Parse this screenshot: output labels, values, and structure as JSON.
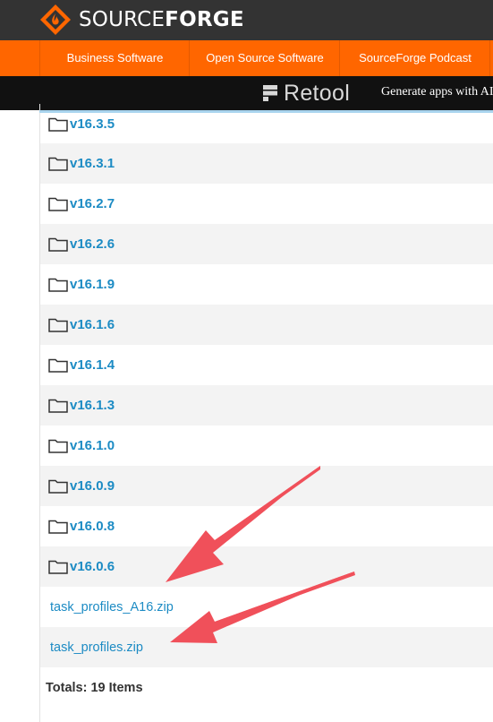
{
  "header": {
    "logo": {
      "text_thin": "SOURCE",
      "text_bold": "FORGE"
    },
    "nav": [
      {
        "label": "Business Software"
      },
      {
        "label": "Open Source Software"
      },
      {
        "label": "SourceForge Podcast"
      }
    ]
  },
  "ad": {
    "brand": "Retool",
    "tagline": "Generate apps with AI"
  },
  "files": {
    "folders": [
      {
        "name": "v16.3.5"
      },
      {
        "name": "v16.3.1"
      },
      {
        "name": "v16.2.7"
      },
      {
        "name": "v16.2.6"
      },
      {
        "name": "v16.1.9"
      },
      {
        "name": "v16.1.6"
      },
      {
        "name": "v16.1.4"
      },
      {
        "name": "v16.1.3"
      },
      {
        "name": "v16.1.0"
      },
      {
        "name": "v16.0.9"
      },
      {
        "name": "v16.0.8"
      },
      {
        "name": "v16.0.6"
      }
    ],
    "zips": [
      {
        "name": "task_profiles_A16.zip"
      },
      {
        "name": "task_profiles.zip"
      }
    ],
    "totals": "Totals: 19 Items"
  },
  "colors": {
    "header_bg": "#333333",
    "nav_bg": "#ff6600",
    "link": "#1c8bc4",
    "annotation_arrow": "#f0505a"
  }
}
